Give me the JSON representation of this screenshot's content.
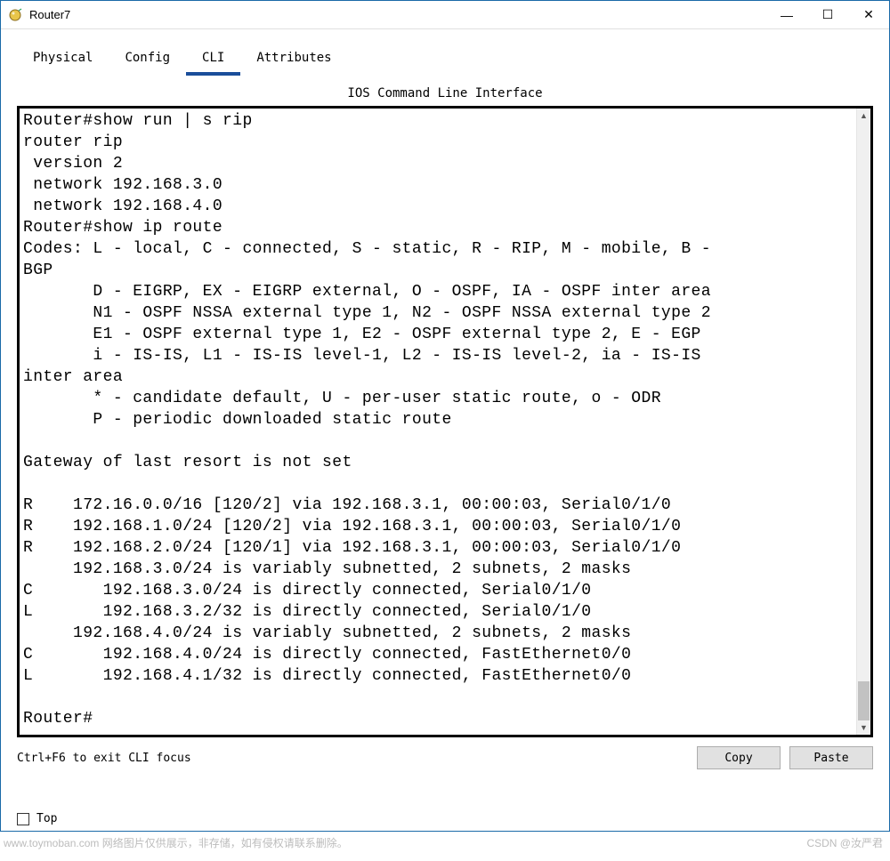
{
  "window": {
    "title": "Router7"
  },
  "win_btn_glyphs": {
    "min": "—",
    "max": "☐",
    "close": "✕"
  },
  "tabs": {
    "physical": "Physical",
    "config": "Config",
    "cli": "CLI",
    "attributes": "Attributes"
  },
  "cli": {
    "header": "IOS Command Line Interface",
    "hint": "Ctrl+F6 to exit CLI focus",
    "copy": "Copy",
    "paste": "Paste"
  },
  "terminal_lines": [
    "Router#show run | s rip",
    "router rip",
    " version 2",
    " network 192.168.3.0",
    " network 192.168.4.0",
    "Router#show ip route",
    "Codes: L - local, C - connected, S - static, R - RIP, M - mobile, B -",
    "BGP",
    "       D - EIGRP, EX - EIGRP external, O - OSPF, IA - OSPF inter area",
    "       N1 - OSPF NSSA external type 1, N2 - OSPF NSSA external type 2",
    "       E1 - OSPF external type 1, E2 - OSPF external type 2, E - EGP",
    "       i - IS-IS, L1 - IS-IS level-1, L2 - IS-IS level-2, ia - IS-IS",
    "inter area",
    "       * - candidate default, U - per-user static route, o - ODR",
    "       P - periodic downloaded static route",
    "",
    "Gateway of last resort is not set",
    "",
    "R    172.16.0.0/16 [120/2] via 192.168.3.1, 00:00:03, Serial0/1/0",
    "R    192.168.1.0/24 [120/2] via 192.168.3.1, 00:00:03, Serial0/1/0",
    "R    192.168.2.0/24 [120/1] via 192.168.3.1, 00:00:03, Serial0/1/0",
    "     192.168.3.0/24 is variably subnetted, 2 subnets, 2 masks",
    "C       192.168.3.0/24 is directly connected, Serial0/1/0",
    "L       192.168.3.2/32 is directly connected, Serial0/1/0",
    "     192.168.4.0/24 is variably subnetted, 2 subnets, 2 masks",
    "C       192.168.4.0/24 is directly connected, FastEthernet0/0",
    "L       192.168.4.1/32 is directly connected, FastEthernet0/0",
    "",
    "Router#"
  ],
  "bottom": {
    "top_label": "Top"
  },
  "footer": {
    "left": "www.toymoban.com 网络图片仅供展示，非存储，如有侵权请联系删除。",
    "right": "CSDN @汝严君"
  }
}
